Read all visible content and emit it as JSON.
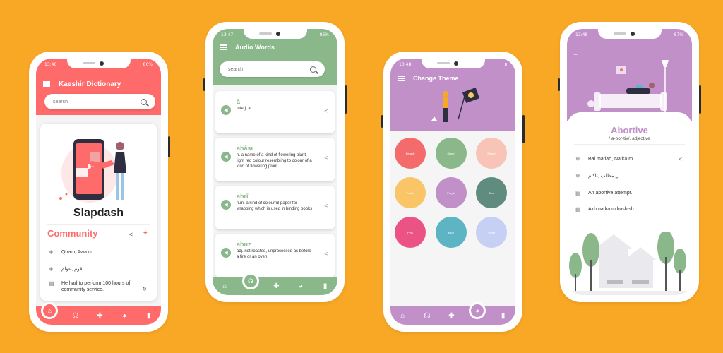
{
  "colors": {
    "background": "#F9A826",
    "red": "#FF6B6B",
    "green": "#8BB88B",
    "purple": "#C190C9"
  },
  "phone1": {
    "time": "13:46",
    "battery": "86%",
    "title": "Kaeshir Dictionary",
    "search_placeholder": "search",
    "word": "Slapdash",
    "category": "Community",
    "rows": [
      {
        "icon": "snowflake-icon",
        "text": "Qoam, Awa:m"
      },
      {
        "icon": "snowflake-icon",
        "text": "قوم ,عوام"
      },
      {
        "icon": "document-icon",
        "text": "He had to perform 100 hours of community service."
      }
    ]
  },
  "phone2": {
    "time": "13:47",
    "battery": "86%",
    "title": "Audio Words",
    "search_placeholder": "search",
    "cards": [
      {
        "word": "ā",
        "def": "interj. a"
      },
      {
        "word": "abāsı",
        "def": "n. a name of a kind of flowering plant, light red colour resembling to colour of a kind of flowering plant"
      },
      {
        "word": "abrī",
        "def": "n.m. a kind of colourful paper for wrapping which is used in binding books"
      },
      {
        "word": "abuz",
        "def": "adj. not roasted, unprocessed as before a fire or an oven"
      }
    ]
  },
  "phone3": {
    "time": "13:48",
    "title": "Change Theme",
    "themes": [
      {
        "name": "Default",
        "color": "#F46B6B"
      },
      {
        "name": "Green",
        "color": "#8BB88B"
      },
      {
        "name": "Peach",
        "color": "#F8C4B7"
      },
      {
        "name": "Yellow",
        "color": "#F9C567"
      },
      {
        "name": "Purple",
        "color": "#C190C9"
      },
      {
        "name": "Teal",
        "color": "#5F8C7E"
      },
      {
        "name": "Pink",
        "color": "#EC5385"
      },
      {
        "name": "Blue",
        "color": "#5DB5C4"
      },
      {
        "name": "Violet",
        "color": "#C5D0F4"
      }
    ]
  },
  "phone4": {
    "time": "13:48",
    "battery": "87%",
    "word": "Abortive",
    "pronunciation": "/ a-bor-tiv/, adjective",
    "rows": [
      {
        "icon": "snowflake-icon",
        "text": "Bai matlab, Na:ka:m"
      },
      {
        "icon": "snowflake-icon",
        "text": "بے مطلب ,ناکام"
      },
      {
        "icon": "document-icon",
        "text": "An abortive attempt."
      },
      {
        "icon": "document-icon",
        "text": "Akh na:ka:m koshish."
      }
    ]
  }
}
